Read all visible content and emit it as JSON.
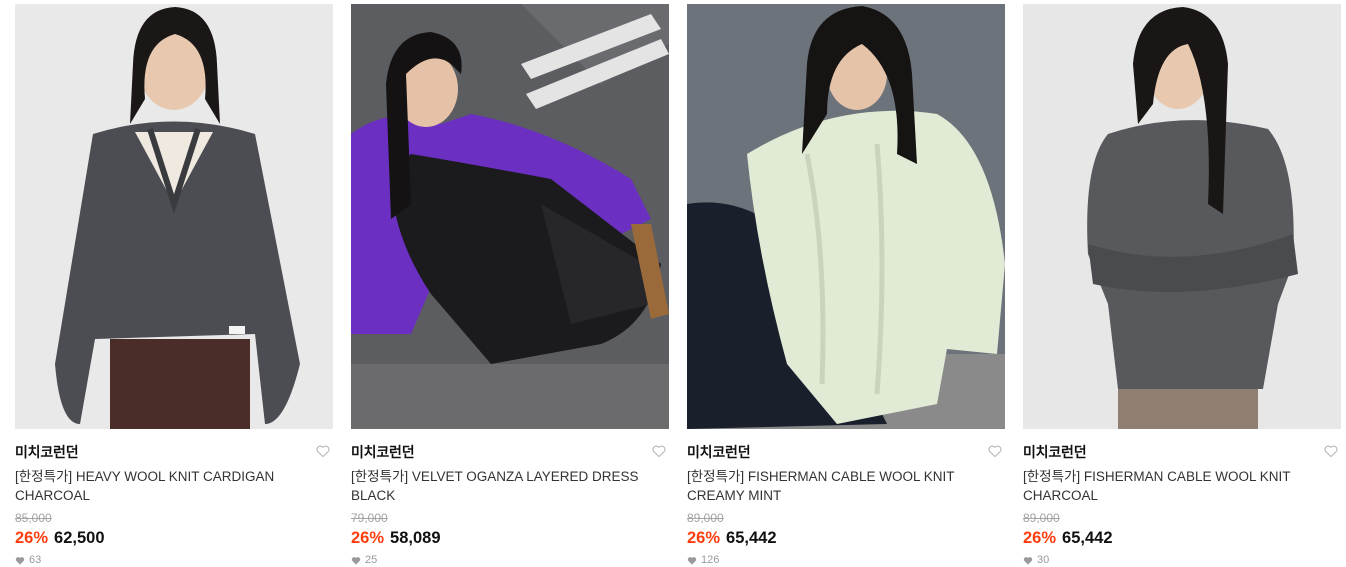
{
  "products": [
    {
      "brand": "미치코런던",
      "name": "[한정특가] HEAVY WOOL KNIT CARDIGAN CHARCOAL",
      "original_price": "85,000",
      "discount": "26%",
      "price": "62,500",
      "likes": "63"
    },
    {
      "brand": "미치코런던",
      "name": "[한정특가] VELVET OGANZA LAYERED DRESS BLACK",
      "original_price": "79,000",
      "discount": "26%",
      "price": "58,089",
      "likes": "25"
    },
    {
      "brand": "미치코런던",
      "name": "[한정특가] FISHERMAN CABLE WOOL KNIT CREAMY MINT",
      "original_price": "89,000",
      "discount": "26%",
      "price": "65,442",
      "likes": "126"
    },
    {
      "brand": "미치코런던",
      "name": "[한정특가] FISHERMAN CABLE WOOL KNIT CHARCOAL",
      "original_price": "89,000",
      "discount": "26%",
      "price": "65,442",
      "likes": "30"
    }
  ],
  "colors": {
    "discount": "#ff3d0f",
    "original_price": "#a3a3a3",
    "brand": "#111111",
    "heart_outline": "#b5b5b5"
  },
  "icons": {
    "wishlist": "heart-outline-icon",
    "likes": "heart-filled-icon"
  }
}
